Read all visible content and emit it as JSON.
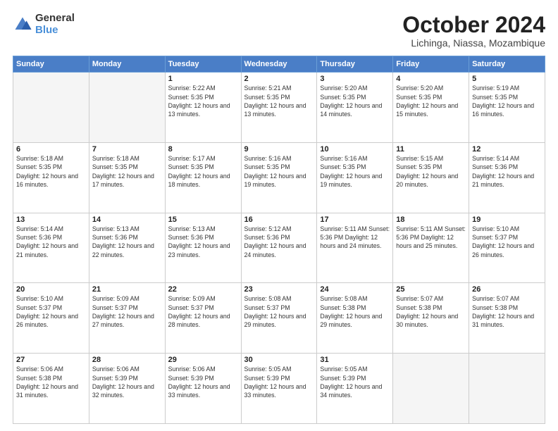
{
  "logo": {
    "general": "General",
    "blue": "Blue"
  },
  "header": {
    "month": "October 2024",
    "location": "Lichinga, Niassa, Mozambique"
  },
  "days_of_week": [
    "Sunday",
    "Monday",
    "Tuesday",
    "Wednesday",
    "Thursday",
    "Friday",
    "Saturday"
  ],
  "weeks": [
    [
      {
        "day": "",
        "info": ""
      },
      {
        "day": "",
        "info": ""
      },
      {
        "day": "1",
        "info": "Sunrise: 5:22 AM\nSunset: 5:35 PM\nDaylight: 12 hours\nand 13 minutes."
      },
      {
        "day": "2",
        "info": "Sunrise: 5:21 AM\nSunset: 5:35 PM\nDaylight: 12 hours\nand 13 minutes."
      },
      {
        "day": "3",
        "info": "Sunrise: 5:20 AM\nSunset: 5:35 PM\nDaylight: 12 hours\nand 14 minutes."
      },
      {
        "day": "4",
        "info": "Sunrise: 5:20 AM\nSunset: 5:35 PM\nDaylight: 12 hours\nand 15 minutes."
      },
      {
        "day": "5",
        "info": "Sunrise: 5:19 AM\nSunset: 5:35 PM\nDaylight: 12 hours\nand 16 minutes."
      }
    ],
    [
      {
        "day": "6",
        "info": "Sunrise: 5:18 AM\nSunset: 5:35 PM\nDaylight: 12 hours\nand 16 minutes."
      },
      {
        "day": "7",
        "info": "Sunrise: 5:18 AM\nSunset: 5:35 PM\nDaylight: 12 hours\nand 17 minutes."
      },
      {
        "day": "8",
        "info": "Sunrise: 5:17 AM\nSunset: 5:35 PM\nDaylight: 12 hours\nand 18 minutes."
      },
      {
        "day": "9",
        "info": "Sunrise: 5:16 AM\nSunset: 5:35 PM\nDaylight: 12 hours\nand 19 minutes."
      },
      {
        "day": "10",
        "info": "Sunrise: 5:16 AM\nSunset: 5:35 PM\nDaylight: 12 hours\nand 19 minutes."
      },
      {
        "day": "11",
        "info": "Sunrise: 5:15 AM\nSunset: 5:35 PM\nDaylight: 12 hours\nand 20 minutes."
      },
      {
        "day": "12",
        "info": "Sunrise: 5:14 AM\nSunset: 5:36 PM\nDaylight: 12 hours\nand 21 minutes."
      }
    ],
    [
      {
        "day": "13",
        "info": "Sunrise: 5:14 AM\nSunset: 5:36 PM\nDaylight: 12 hours\nand 21 minutes."
      },
      {
        "day": "14",
        "info": "Sunrise: 5:13 AM\nSunset: 5:36 PM\nDaylight: 12 hours\nand 22 minutes."
      },
      {
        "day": "15",
        "info": "Sunrise: 5:13 AM\nSunset: 5:36 PM\nDaylight: 12 hours\nand 23 minutes."
      },
      {
        "day": "16",
        "info": "Sunrise: 5:12 AM\nSunset: 5:36 PM\nDaylight: 12 hours\nand 24 minutes."
      },
      {
        "day": "17",
        "info": "Sunrise: 5:11 AM\nSunset: 5:36 PM\nDaylight: 12 hours\nand 24 minutes."
      },
      {
        "day": "18",
        "info": "Sunrise: 5:11 AM\nSunset: 5:36 PM\nDaylight: 12 hours\nand 25 minutes."
      },
      {
        "day": "19",
        "info": "Sunrise: 5:10 AM\nSunset: 5:37 PM\nDaylight: 12 hours\nand 26 minutes."
      }
    ],
    [
      {
        "day": "20",
        "info": "Sunrise: 5:10 AM\nSunset: 5:37 PM\nDaylight: 12 hours\nand 26 minutes."
      },
      {
        "day": "21",
        "info": "Sunrise: 5:09 AM\nSunset: 5:37 PM\nDaylight: 12 hours\nand 27 minutes."
      },
      {
        "day": "22",
        "info": "Sunrise: 5:09 AM\nSunset: 5:37 PM\nDaylight: 12 hours\nand 28 minutes."
      },
      {
        "day": "23",
        "info": "Sunrise: 5:08 AM\nSunset: 5:37 PM\nDaylight: 12 hours\nand 29 minutes."
      },
      {
        "day": "24",
        "info": "Sunrise: 5:08 AM\nSunset: 5:38 PM\nDaylight: 12 hours\nand 29 minutes."
      },
      {
        "day": "25",
        "info": "Sunrise: 5:07 AM\nSunset: 5:38 PM\nDaylight: 12 hours\nand 30 minutes."
      },
      {
        "day": "26",
        "info": "Sunrise: 5:07 AM\nSunset: 5:38 PM\nDaylight: 12 hours\nand 31 minutes."
      }
    ],
    [
      {
        "day": "27",
        "info": "Sunrise: 5:06 AM\nSunset: 5:38 PM\nDaylight: 12 hours\nand 31 minutes."
      },
      {
        "day": "28",
        "info": "Sunrise: 5:06 AM\nSunset: 5:39 PM\nDaylight: 12 hours\nand 32 minutes."
      },
      {
        "day": "29",
        "info": "Sunrise: 5:06 AM\nSunset: 5:39 PM\nDaylight: 12 hours\nand 33 minutes."
      },
      {
        "day": "30",
        "info": "Sunrise: 5:05 AM\nSunset: 5:39 PM\nDaylight: 12 hours\nand 33 minutes."
      },
      {
        "day": "31",
        "info": "Sunrise: 5:05 AM\nSunset: 5:39 PM\nDaylight: 12 hours\nand 34 minutes."
      },
      {
        "day": "",
        "info": ""
      },
      {
        "day": "",
        "info": ""
      }
    ]
  ]
}
